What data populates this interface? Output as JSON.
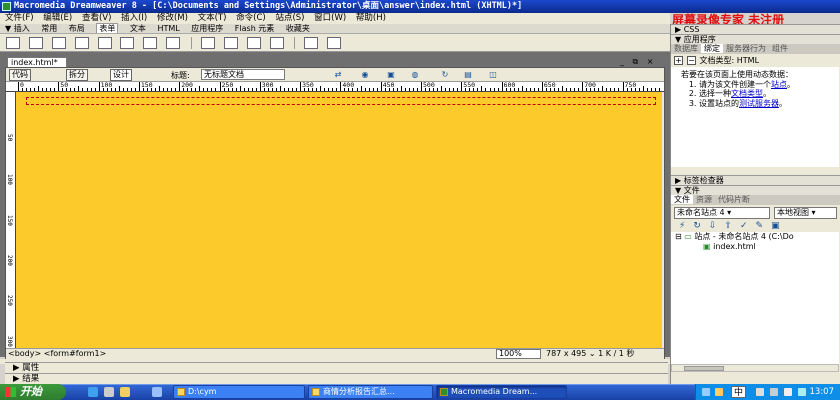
{
  "window": {
    "title": "Macromedia Dreamweaver 8 - [C:\\Documents and Settings\\Administrator\\桌面\\answer\\index.html (XHTML)*]"
  },
  "watermark": "屏幕录像专家 未注册",
  "menu": [
    "文件(F)",
    "编辑(E)",
    "查看(V)",
    "插入(I)",
    "修改(M)",
    "文本(T)",
    "命令(C)",
    "站点(S)",
    "窗口(W)",
    "帮助(H)"
  ],
  "insert_bar": {
    "label": "▼ 插入",
    "tabs": [
      "常用",
      "布局",
      "表单",
      "文本",
      "HTML",
      "应用程序",
      "Flash 元素",
      "收藏夹"
    ],
    "selected": "表单"
  },
  "document": {
    "tab_label": "index.html*",
    "views": [
      "代码",
      "拆分",
      "设计"
    ],
    "active_view": "设计",
    "title_label": "标题:",
    "title_value": "无标题文档",
    "window_controls": "_ ⧉ ×",
    "ruler_ticks": [
      "0",
      "50",
      "100",
      "150",
      "200",
      "250",
      "300",
      "350",
      "400",
      "450",
      "500",
      "550",
      "600",
      "650",
      "700",
      "750"
    ],
    "vruler_ticks": [
      "50",
      "100",
      "150",
      "200",
      "250",
      "300"
    ],
    "canvas_color": "#fccb2b",
    "form_outline_color": "#c00000"
  },
  "status": {
    "tag_selector": "<body> <form#form1>",
    "zoom": "100%",
    "size_info": "787 x 495 ⌄ 1 K / 1 秒"
  },
  "bottom_panels": {
    "properties": "▶ 属性",
    "results": "▶ 结果"
  },
  "right_panels": {
    "css_header": "▶ CSS",
    "app_header": "▼ 应用程序",
    "app_tabs": [
      "数据库",
      "绑定",
      "服务器行为",
      "组件"
    ],
    "app_selected_tab": "绑定",
    "doc_type_label": "文档类型: HTML",
    "app_intro": "若要在该页面上使用动态数据：",
    "app_steps": [
      {
        "pre": "请为该文件创建一个",
        "link": "站点",
        "post": "。"
      },
      {
        "pre": "选择一种",
        "link": "文档类型",
        "post": "。"
      },
      {
        "pre": "设置站点的",
        "link": "测试服务器",
        "post": "。"
      }
    ],
    "tag_inspector_header": "▶ 标签检查器",
    "files_header": "▼ 文件",
    "files_tabs": [
      "文件",
      "资源",
      "代码片断"
    ],
    "files_selected_tab": "文件",
    "site_select": "未命名站点 4",
    "view_select": "本地视图",
    "tree_root": "站点 - 未命名站点 4 (C:\\Do",
    "tree_file": "index.html"
  },
  "taskbar": {
    "start_label": "开始",
    "tasks": [
      {
        "label": "D:\\cym",
        "active": false
      },
      {
        "label": "商情分析报告汇总...",
        "active": false
      },
      {
        "label": "Macromedia Dream...",
        "active": true
      }
    ],
    "ime_label": "中",
    "clock": "13:07"
  }
}
